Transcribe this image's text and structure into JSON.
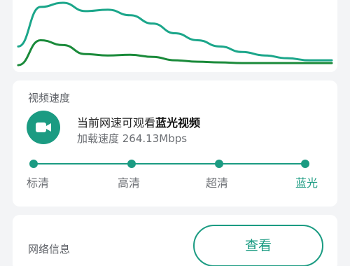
{
  "chart": {
    "colors": {
      "upper_line": "#1ba68a",
      "lower_line": "#1a8a3a"
    },
    "upper_series": [
      35,
      92,
      98,
      86,
      88,
      80,
      68,
      54,
      44,
      35,
      27,
      22,
      18,
      15,
      15
    ],
    "lower_series": [
      8,
      44,
      37,
      24,
      22,
      23,
      20,
      15,
      13,
      12,
      11,
      11,
      11,
      11,
      11
    ]
  },
  "speed_card": {
    "title": "视频速度",
    "headline_prefix": "当前网速可观看",
    "headline_quality": "蓝光视频",
    "subline": "加载速度 264.13Mbps",
    "icon": "video-camera-icon",
    "accent_color": "#1b9b82",
    "levels": [
      "标清",
      "高清",
      "超清",
      "蓝光"
    ],
    "active_level": "蓝光"
  },
  "network_card": {
    "title": "网络信息",
    "view_button": "查看"
  }
}
